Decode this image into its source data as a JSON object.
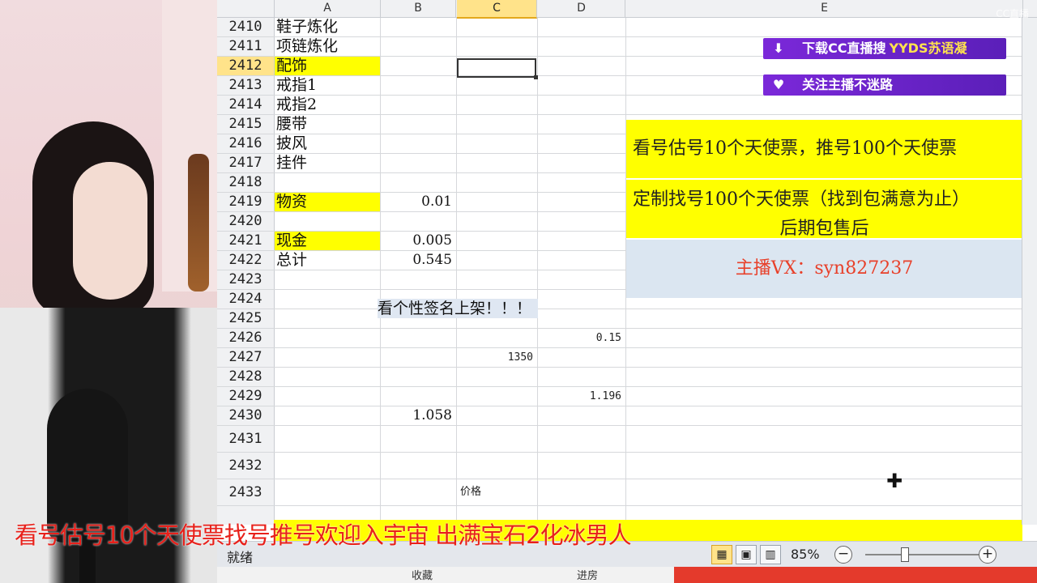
{
  "columns": [
    "A",
    "B",
    "C",
    "D",
    "E"
  ],
  "selected_column": "C",
  "rows": [
    {
      "num": "2410",
      "a": "鞋子炼化",
      "b": "",
      "c": "",
      "d": ""
    },
    {
      "num": "2411",
      "a": "项链炼化",
      "b": "",
      "c": "",
      "d": ""
    },
    {
      "num": "2412",
      "a": "配饰",
      "b": "",
      "c": "",
      "d": "",
      "yellow": true,
      "selected": true
    },
    {
      "num": "2413",
      "a": "戒指1",
      "b": "",
      "c": "",
      "d": ""
    },
    {
      "num": "2414",
      "a": "戒指2",
      "b": "",
      "c": "",
      "d": ""
    },
    {
      "num": "2415",
      "a": "腰带",
      "b": "",
      "c": "",
      "d": ""
    },
    {
      "num": "2416",
      "a": "披风",
      "b": "",
      "c": "",
      "d": ""
    },
    {
      "num": "2417",
      "a": "挂件",
      "b": "",
      "c": "",
      "d": ""
    },
    {
      "num": "2418",
      "a": "",
      "b": "",
      "c": "",
      "d": ""
    },
    {
      "num": "2419",
      "a": "物资",
      "b": "0.01",
      "c": "",
      "d": "",
      "yellow": true
    },
    {
      "num": "2420",
      "a": "",
      "b": "",
      "c": "",
      "d": ""
    },
    {
      "num": "2421",
      "a": "现金",
      "b": "0.005",
      "c": "",
      "d": "",
      "yellow": true
    },
    {
      "num": "2422",
      "a": "总计",
      "b": "0.545",
      "c": "",
      "d": ""
    },
    {
      "num": "2423",
      "a": "",
      "b": "",
      "c": "",
      "d": ""
    },
    {
      "num": "2424",
      "a": "",
      "b": "",
      "c": "",
      "d": ""
    },
    {
      "num": "2425",
      "a": "",
      "b": "",
      "c": "",
      "d": ""
    },
    {
      "num": "2426",
      "a": "",
      "b": "",
      "c": "",
      "d": "0.15"
    },
    {
      "num": "2427",
      "a": "",
      "b": "",
      "c": "1350",
      "d": ""
    },
    {
      "num": "2428",
      "a": "",
      "b": "",
      "c": "",
      "d": ""
    },
    {
      "num": "2429",
      "a": "",
      "b": "",
      "c": "",
      "d": "1.196"
    },
    {
      "num": "2430",
      "a": "",
      "b": "1.058",
      "c": "",
      "d": ""
    },
    {
      "num": "2431",
      "a": "",
      "b": "",
      "c": "",
      "d": ""
    },
    {
      "num": "2432",
      "a": "",
      "b": "",
      "c": "",
      "d": ""
    },
    {
      "num": "2433",
      "a": "",
      "b": "",
      "c": "价格",
      "d": ""
    }
  ],
  "row_2424_text": "看个性签名上架！！！",
  "ads": {
    "download_label": "下载CC直播搜",
    "download_highlight": "YYDS苏语凝",
    "follow_label": "关注主播不迷路"
  },
  "promo": {
    "line1": "看号估号10个天使票，推号100个天使票",
    "line2": "定制找号100个天使票（找到包满意为止）",
    "line3": "后期包售后",
    "contact": "主播VX：syn827237"
  },
  "status": {
    "ready": "就绪",
    "zoom": "85%",
    "zoom_out": "−",
    "zoom_in": "+"
  },
  "bottom_tabs": {
    "left": "收藏",
    "right": "进房"
  },
  "caption": "看号估号10个天使票找号推号欢迎入宇宙 出满宝石2化冰男人",
  "watermark": "CC直播"
}
